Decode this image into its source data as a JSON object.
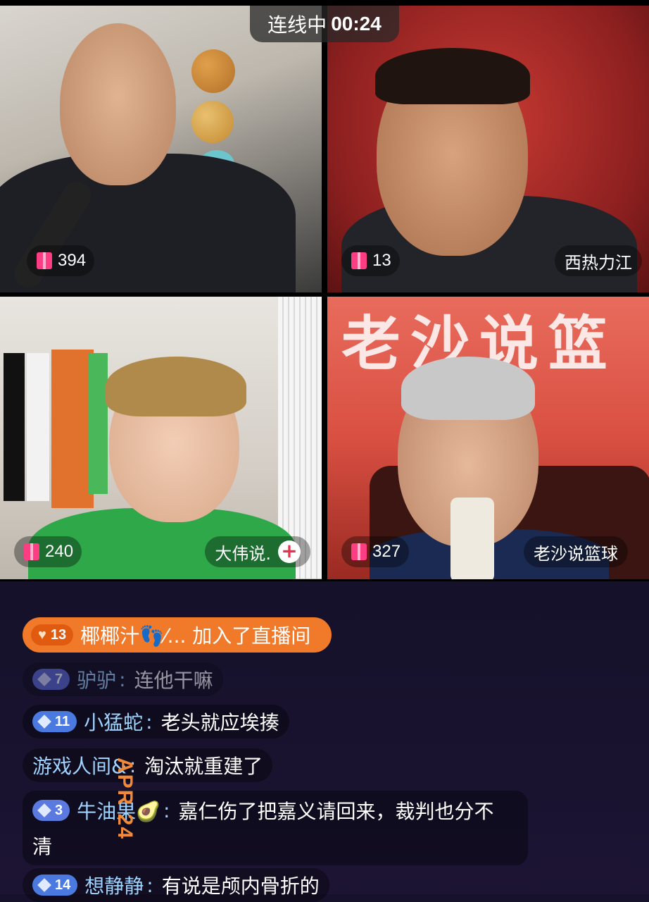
{
  "timer": {
    "label": "连线中",
    "time": "00:24"
  },
  "tiles": [
    {
      "gift_count": "394",
      "name": ""
    },
    {
      "gift_count": "13",
      "name": "西热力江"
    },
    {
      "gift_count": "240",
      "name": "大伟说."
    },
    {
      "gift_count": "327",
      "name": "老沙说篮球"
    }
  ],
  "banner": {
    "text": "老沙说篮"
  },
  "join": {
    "level": "13",
    "text": "椰椰汁👣⁄... 加入了直播间"
  },
  "messages": [
    {
      "level": "7",
      "name": "驴驴",
      "text": "连他干嘛"
    },
    {
      "level": "11",
      "name": "小猛蛇",
      "text": "老头就应埃揍"
    },
    {
      "level": "",
      "name": "游戏人间&",
      "text": "淘汰就重建了"
    },
    {
      "level": "3",
      "name": "牛油果🥑",
      "text": "嘉仁伤了把嘉义请回来，裁判也分不",
      "text2": "清"
    },
    {
      "level": "14",
      "name": "想静静",
      "text": "有说是颅内骨折的"
    }
  ],
  "watermark": "APR 24",
  "colors": {
    "join_bg": "#f07a2a",
    "gift_icon": "#ff3d83",
    "name_color": "#9fd4ff",
    "chat_bg": "#17122b"
  }
}
